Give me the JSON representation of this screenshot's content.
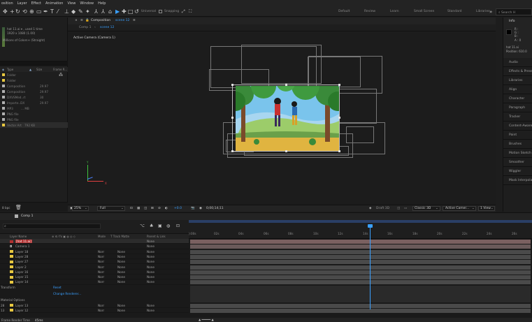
{
  "menu": [
    "osition",
    "Layer",
    "Effect",
    "Animation",
    "View",
    "Window",
    "Help"
  ],
  "toolbar": {
    "universal": "Universal",
    "snapping": "Snapping",
    "workspaces": [
      "Default",
      "Review",
      "Learn",
      "Small Screen",
      "Standard",
      "Libraries"
    ],
    "search_placeholder": "Search H"
  },
  "project": {
    "info_name": "hat 11.ai ▾ , used 1 time",
    "info_size": "1920 x 1080 (1.00)",
    "info_colors": "Millions of Colors+ (Straight)",
    "columns": [
      "Type",
      "Size",
      "Frame R..."
    ],
    "items": [
      {
        "type": "Folder",
        "size": "",
        "fps": "",
        "color": "#e8c840"
      },
      {
        "type": "Folder",
        "size": "",
        "fps": "",
        "color": "#e8c840"
      },
      {
        "type": "Composition",
        "size": "",
        "fps": "29.97",
        "color": "#b0b0b0"
      },
      {
        "type": "Composition",
        "size": "",
        "fps": "29.97",
        "color": "#b0b0b0"
      },
      {
        "type": "DXVSMed..rt",
        "size": "",
        "fps": "30",
        "color": "#b0b0b0"
      },
      {
        "type": "Importe..DX",
        "size": "",
        "fps": "29.97",
        "color": "#b0b0b0"
      },
      {
        "type": "MP3",
        "size": "... MB",
        "fps": "",
        "color": "#b0b0b0"
      },
      {
        "type": "PNG file",
        "size": "",
        "fps": "",
        "color": "#b0b0b0"
      },
      {
        "type": "PNG file",
        "size": "",
        "fps": "",
        "color": "#b0b0b0"
      },
      {
        "type": "Vector Art",
        "size": "792 KB",
        "fps": "",
        "color": "#e8c840"
      }
    ],
    "bpc": "8 bpc"
  },
  "composition": {
    "panel_title": "Composition",
    "panel_name": "scene 12",
    "breadcrumb_1": "Comp 1",
    "breadcrumb_2": "scene 12",
    "active_camera": "Active Camera (Camera 1)",
    "zoom": "25%",
    "resolution": "Full",
    "exposure": "+0.0",
    "timecode": "0;00;14;11",
    "draft3d": "Draft 3D",
    "renderer": "Classic 3D",
    "camera_view": "Active Camer...",
    "views": "1 View",
    "axis_y": "Y",
    "axis_x": "X"
  },
  "right_panel": {
    "info_title": "Info",
    "r_label": "R :",
    "g_label": "G :",
    "b_label": "B :",
    "a_label": "A : 0",
    "layer_info": "hat 11.ai",
    "position": "Position: 610.0",
    "panels": [
      "Audio",
      "Effects & Presets",
      "Libraries",
      "Align",
      "Character",
      "Paragraph",
      "Tracker",
      "Content-Aware Fill",
      "Paint",
      "Brushes",
      "Motion Sketch",
      "Smoother",
      "Wiggler",
      "Mask Interpolation"
    ]
  },
  "timeline": {
    "tab": "Comp 1",
    "columns": [
      "Layer Name",
      "Mode",
      "T Track Matte",
      "Parent & Link"
    ],
    "layers": [
      {
        "num": "",
        "name": "[hat 11.ai]",
        "color": "#b03030",
        "mode": "",
        "parent": "None"
      },
      {
        "num": "",
        "name": "Camera 1",
        "color": "#c8c8c8",
        "mode": "",
        "parent": "None"
      },
      {
        "num": "",
        "name": "Layer 18",
        "color": "#e8c840",
        "mode": "Norr",
        "parent": "None"
      },
      {
        "num": "",
        "name": "Layer 28",
        "color": "#e8c840",
        "mode": "Norr",
        "parent": "None"
      },
      {
        "num": "",
        "name": "Layer 27",
        "color": "#e8c840",
        "mode": "Norr",
        "parent": "None"
      },
      {
        "num": "",
        "name": "Layer 2",
        "color": "#e8c840",
        "mode": "Norr",
        "parent": "None"
      },
      {
        "num": "",
        "name": "Layer 16",
        "color": "#e8c840",
        "mode": "Norr",
        "parent": "None"
      },
      {
        "num": "",
        "name": "Layer 15",
        "color": "#e8c840",
        "mode": "Norr",
        "parent": "None"
      },
      {
        "num": "",
        "name": "Layer 14",
        "color": "#e8c840",
        "mode": "Norr",
        "parent": "None"
      }
    ],
    "transform_label": "Transform",
    "reset_label": "Reset",
    "change_renderer": "Change Renderer...",
    "material_options": "Material Options",
    "layers_bottom": [
      {
        "num": "28",
        "name": "Layer 13",
        "color": "#e8c840",
        "mode": "Norr",
        "parent": "None"
      },
      {
        "num": "13",
        "name": "Layer 12",
        "color": "#e8c840",
        "mode": "Norr",
        "parent": "None"
      }
    ],
    "track_matte_value": "None",
    "ticks": [
      "):00s",
      "02s",
      "04s",
      "06s",
      "08s",
      "10s",
      "12s",
      "14s",
      "16s",
      "18s",
      "20s",
      "22s",
      "24s",
      "26s"
    ],
    "frame_render_time": "Frame Render Time",
    "frame_render_value": "45ms"
  },
  "colors": {
    "accent": "#3aa0ff",
    "panel": "#232323",
    "background": "#1d1d1d"
  }
}
